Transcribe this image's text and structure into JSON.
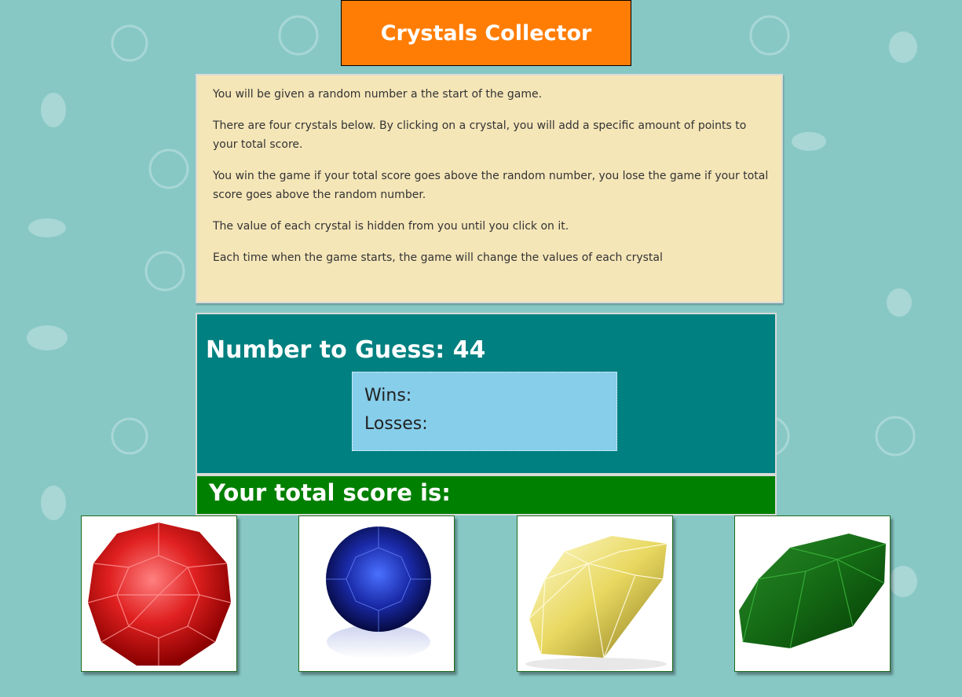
{
  "header": {
    "title": "Crystals Collector"
  },
  "instructions": [
    "You will be given a random number a the start of the game.",
    "There are four crystals below. By clicking on a crystal, you will add a specific amount of points to your total score.",
    "You win the game if your total score goes above the random number, you lose the game if your total score goes above the random number.",
    "The value of each crystal is hidden from you until you click on it.",
    "Each time when the game starts, the game will change the values of each crystal"
  ],
  "game": {
    "number_to_guess_label": "Number to Guess: 44",
    "wins_label": "Wins:",
    "losses_label": "Losses:",
    "total_score_label": "Your total score is:"
  },
  "crystals": [
    {
      "name": "red-crystal",
      "color": "#d81818"
    },
    {
      "name": "blue-crystal",
      "color": "#1a2a9a"
    },
    {
      "name": "yellow-crystal",
      "color": "#e8d860"
    },
    {
      "name": "green-crystal",
      "color": "#1a7a1a"
    }
  ]
}
